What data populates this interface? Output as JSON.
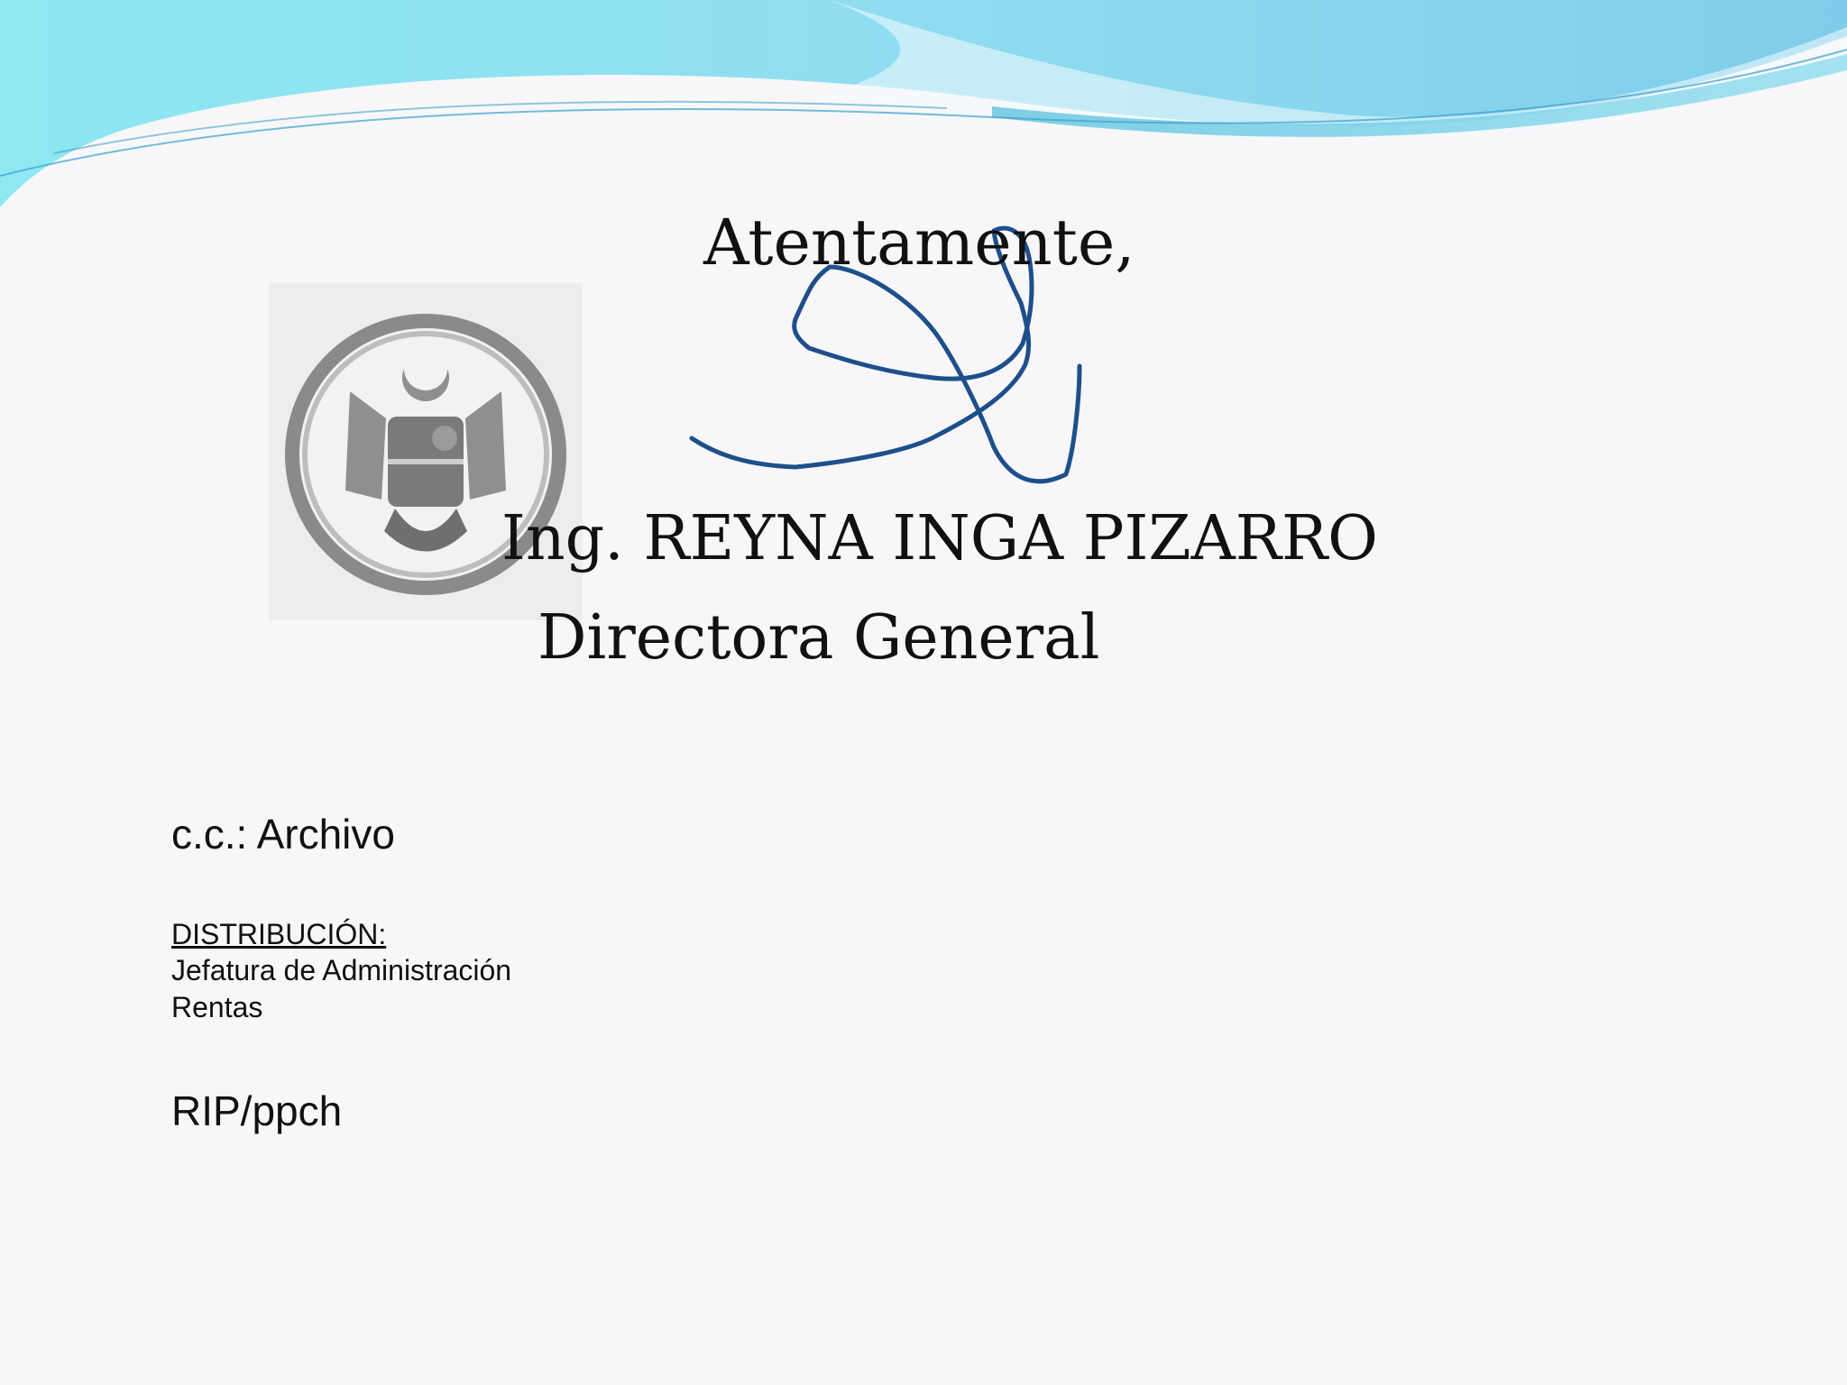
{
  "closing": "Atentamente,",
  "signatory": {
    "name": "Ing. REYNA INGA PIZARRO",
    "title": "Directora General"
  },
  "cc": "c.c.: Archivo",
  "distribution": {
    "heading": "DISTRIBUCIÓN:",
    "recipients": [
      "Jefatura de Administración",
      "Rentas"
    ]
  },
  "reference": "RIP/ppch",
  "colors": {
    "banner_light": "#8de8f2",
    "banner_mid": "#7fd0e8",
    "banner_dark": "#4fb0d6",
    "signature_ink": "#1e4f8a",
    "seal_gray": "#8a8a8a"
  }
}
